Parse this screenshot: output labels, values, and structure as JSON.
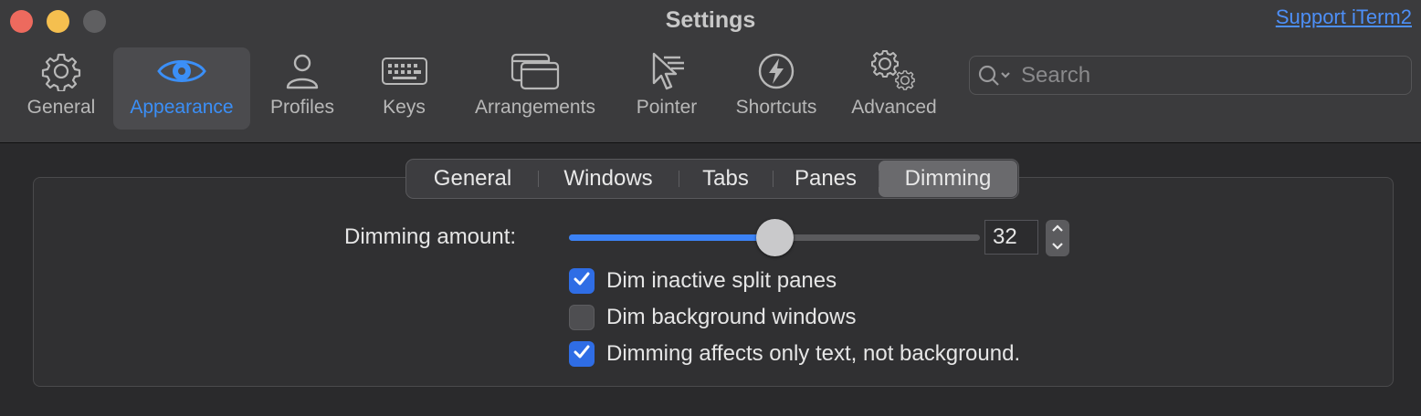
{
  "window": {
    "title": "Settings",
    "support_link": "Support iTerm2"
  },
  "toolbar": {
    "items": [
      {
        "label": "General",
        "icon": "gear-icon",
        "selected": false
      },
      {
        "label": "Appearance",
        "icon": "eye-icon",
        "selected": true
      },
      {
        "label": "Profiles",
        "icon": "person-icon",
        "selected": false
      },
      {
        "label": "Keys",
        "icon": "keyboard-icon",
        "selected": false
      },
      {
        "label": "Arrangements",
        "icon": "windows-icon",
        "selected": false
      },
      {
        "label": "Pointer",
        "icon": "pointer-icon",
        "selected": false
      },
      {
        "label": "Shortcuts",
        "icon": "bolt-icon",
        "selected": false
      },
      {
        "label": "Advanced",
        "icon": "gears-icon",
        "selected": false
      }
    ]
  },
  "search": {
    "placeholder": "Search",
    "value": ""
  },
  "subtabs": {
    "items": [
      "General",
      "Windows",
      "Tabs",
      "Panes",
      "Dimming"
    ],
    "active": "Dimming"
  },
  "dimming": {
    "amount_label": "Dimming amount:",
    "amount_value": "32",
    "slider_fraction": 0.5,
    "checkboxes": [
      {
        "label": "Dim inactive split panes",
        "checked": true
      },
      {
        "label": "Dim background windows",
        "checked": false
      },
      {
        "label": "Dimming affects only text, not background.",
        "checked": true
      }
    ]
  },
  "colors": {
    "accent": "#3b82f6",
    "selected_tab_label": "#3b8ff7",
    "link": "#4d8ff7"
  }
}
